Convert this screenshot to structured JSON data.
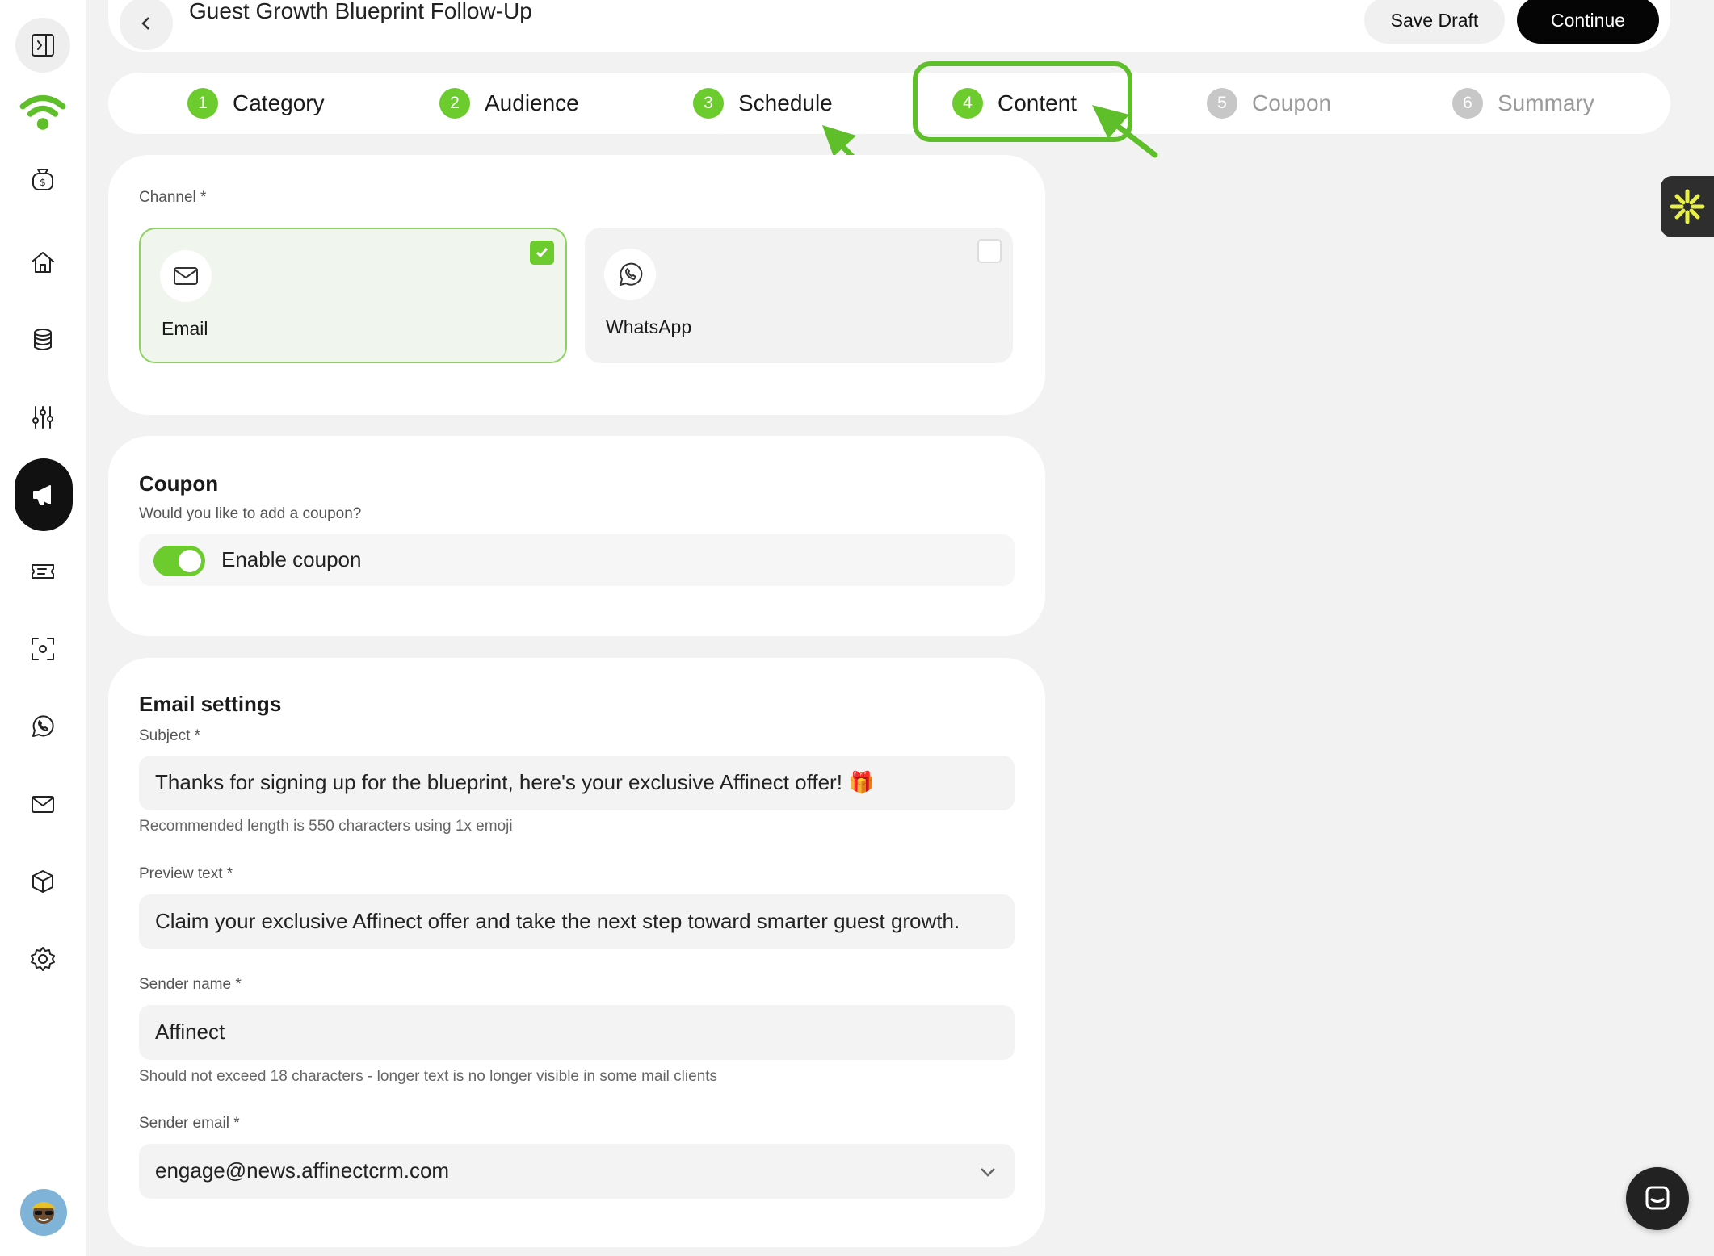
{
  "header": {
    "title": "Guest Growth Blueprint Follow-Up",
    "save_draft_label": "Save Draft",
    "continue_label": "Continue"
  },
  "stepper": {
    "steps": [
      {
        "num": "1",
        "label": "Category",
        "state": "done"
      },
      {
        "num": "2",
        "label": "Audience",
        "state": "done"
      },
      {
        "num": "3",
        "label": "Schedule",
        "state": "done"
      },
      {
        "num": "4",
        "label": "Content",
        "state": "current"
      },
      {
        "num": "5",
        "label": "Coupon",
        "state": "todo"
      },
      {
        "num": "6",
        "label": "Summary",
        "state": "todo"
      }
    ]
  },
  "sidebar": {
    "items": [
      {
        "icon": "sidebar-collapse-icon"
      },
      {
        "icon": "wifi-logo-icon"
      },
      {
        "icon": "money-bag-icon"
      },
      {
        "icon": "home-icon"
      },
      {
        "icon": "database-icon"
      },
      {
        "icon": "sliders-icon"
      },
      {
        "icon": "megaphone-icon",
        "active": true
      },
      {
        "icon": "ticket-icon"
      },
      {
        "icon": "scan-icon"
      },
      {
        "icon": "whatsapp-icon"
      },
      {
        "icon": "mail-icon"
      },
      {
        "icon": "box-icon"
      },
      {
        "icon": "gear-icon"
      }
    ]
  },
  "channel": {
    "label": "Channel *",
    "options": [
      {
        "name": "Email",
        "selected": true,
        "icon": "mail-icon"
      },
      {
        "name": "WhatsApp",
        "selected": false,
        "icon": "whatsapp-icon"
      }
    ]
  },
  "coupon": {
    "title": "Coupon",
    "question": "Would you like to add a coupon?",
    "toggle_label": "Enable coupon",
    "enabled": true
  },
  "email_settings": {
    "title": "Email settings",
    "subject_label": "Subject *",
    "subject_value": "Thanks for signing up for the blueprint, here's your exclusive Affinect offer! 🎁",
    "subject_hint": "Recommended length is 550 characters using 1x emoji",
    "preview_label": "Preview text *",
    "preview_value": "Claim your exclusive Affinect offer and take the next step toward smarter guest growth.",
    "sender_name_label": "Sender name *",
    "sender_name_value": "Affinect",
    "sender_name_hint": "Should not exceed 18 characters - longer text is no longer visible in some mail clients",
    "sender_email_label": "Sender email *",
    "sender_email_value": "engage@news.affinectcrm.com"
  },
  "colors": {
    "accent_green": "#6ccc2e",
    "annotation_green": "#5fbf2a",
    "primary_button": "#050505",
    "background": "#f2f2f2"
  }
}
